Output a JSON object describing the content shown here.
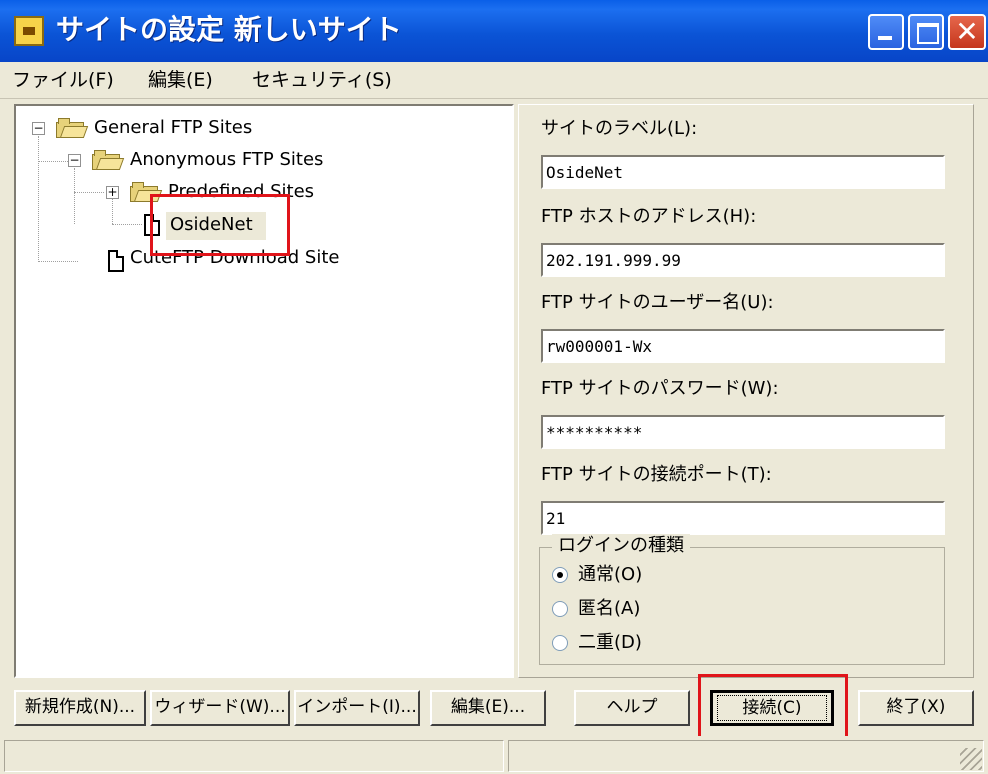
{
  "window": {
    "title": "サイトの設定 新しいサイト",
    "close_glyph": "✕"
  },
  "menu": [
    "ファイル(F)",
    "編集(E)",
    "セキュリティ(S)"
  ],
  "tree": {
    "root": "General FTP Sites",
    "anonymous": "Anonymous FTP Sites",
    "predefined": "Predefined Sites",
    "selected_site": "OsideNet",
    "download_site": "CuteFTP Download Site",
    "expanded_glyph": "−",
    "collapsed_glyph": "+"
  },
  "fields": {
    "label": {
      "label": "サイトのラベル(L):",
      "value": "OsideNet"
    },
    "host": {
      "label": "FTP ホストのアドレス(H):",
      "value": "202.191.999.99"
    },
    "user": {
      "label": "FTP サイトのユーザー名(U):",
      "value": "rw000001-Wx"
    },
    "password": {
      "label": "FTP サイトのパスワード(W):",
      "value": "**********"
    },
    "port": {
      "label": "FTP サイトの接続ポート(T):",
      "value": "21"
    }
  },
  "login_type": {
    "legend": "ログインの種類",
    "options": [
      "通常(O)",
      "匿名(A)",
      "二重(D)"
    ],
    "selected": "通常(O)"
  },
  "buttons": {
    "new": "新規作成(N)...",
    "wizard": "ウィザード(W)...",
    "import": "インポート(I)...",
    "edit": "編集(E)...",
    "help": "ヘルプ",
    "connect": "接続(C)",
    "exit": "終了(X)"
  },
  "colors": {
    "titlebar": "#0b54d6",
    "highlight": "#e0141a",
    "face": "#ece9d8"
  }
}
